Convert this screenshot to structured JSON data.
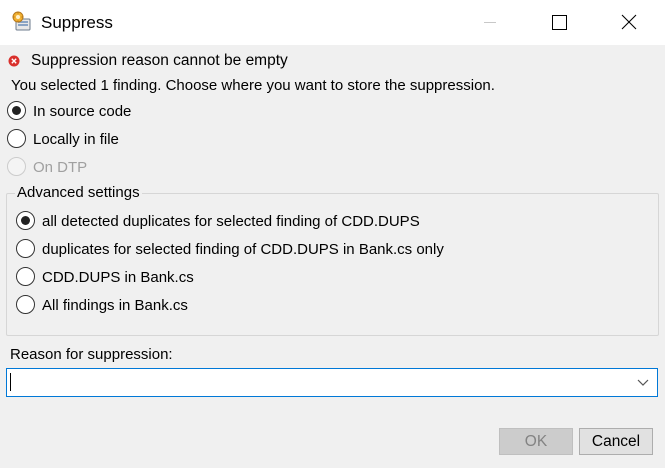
{
  "window": {
    "title": "Suppress",
    "app_icon": "suppress-app-icon",
    "controls": [
      "minimize-icon",
      "maximize-icon",
      "close-icon"
    ]
  },
  "error": {
    "icon": "error-icon",
    "color": "#d9302c",
    "message": "Suppression reason cannot be empty"
  },
  "info": "You selected 1 finding. Choose where you want to store the suppression.",
  "storage_options": [
    {
      "label": "In source code",
      "selected": true,
      "enabled": true
    },
    {
      "label": "Locally in file",
      "selected": false,
      "enabled": true
    },
    {
      "label": "On DTP",
      "selected": false,
      "enabled": false
    }
  ],
  "advanced": {
    "title": "Advanced settings",
    "options": [
      {
        "label": "all detected duplicates for selected finding of CDD.DUPS",
        "selected": true
      },
      {
        "label": "duplicates for selected finding of CDD.DUPS in Bank.cs only",
        "selected": false
      },
      {
        "label": "CDD.DUPS in Bank.cs",
        "selected": false
      },
      {
        "label": "All findings in Bank.cs",
        "selected": false
      }
    ]
  },
  "reason": {
    "label": "Reason for suppression:",
    "value": "",
    "focus_color": "#0078d7"
  },
  "buttons": {
    "ok": "OK",
    "ok_enabled": false,
    "cancel": "Cancel"
  }
}
